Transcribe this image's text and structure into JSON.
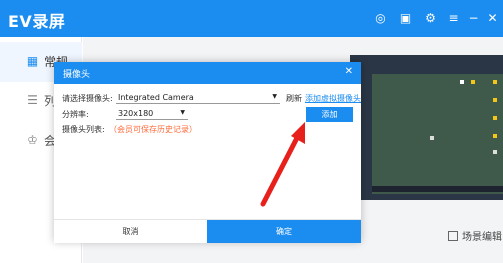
{
  "app": {
    "title": "EV录屏"
  },
  "titlebar_icons": [
    "settings-icon",
    "info-icon",
    "gear-icon",
    "menu-icon",
    "minimize-icon",
    "close-icon"
  ],
  "sidebar": {
    "items": [
      {
        "label": "常规",
        "icon": "grid-icon",
        "active": true
      },
      {
        "label": "列表",
        "icon": "list-icon",
        "active": false
      },
      {
        "label": "会员",
        "icon": "crown-icon",
        "active": false
      }
    ]
  },
  "scene_edit": {
    "label": "场景编辑"
  },
  "dialog": {
    "title": "摄像头",
    "camera_label": "请选择摄像头:",
    "camera_value": "Integrated Camera",
    "refresh_label": "刷新",
    "add_virtual_label": "添加虚拟摄像头",
    "resolution_label": "分辨率:",
    "resolution_value": "320x180",
    "add_label": "添加",
    "list_label": "摄像头列表:",
    "list_hint": "（会员可保存历史记录）",
    "cancel_label": "取消",
    "ok_label": "确定"
  },
  "colors": {
    "accent": "#1b8cf0",
    "hint": "#ff6a3a",
    "arrow": "#e8201c"
  }
}
